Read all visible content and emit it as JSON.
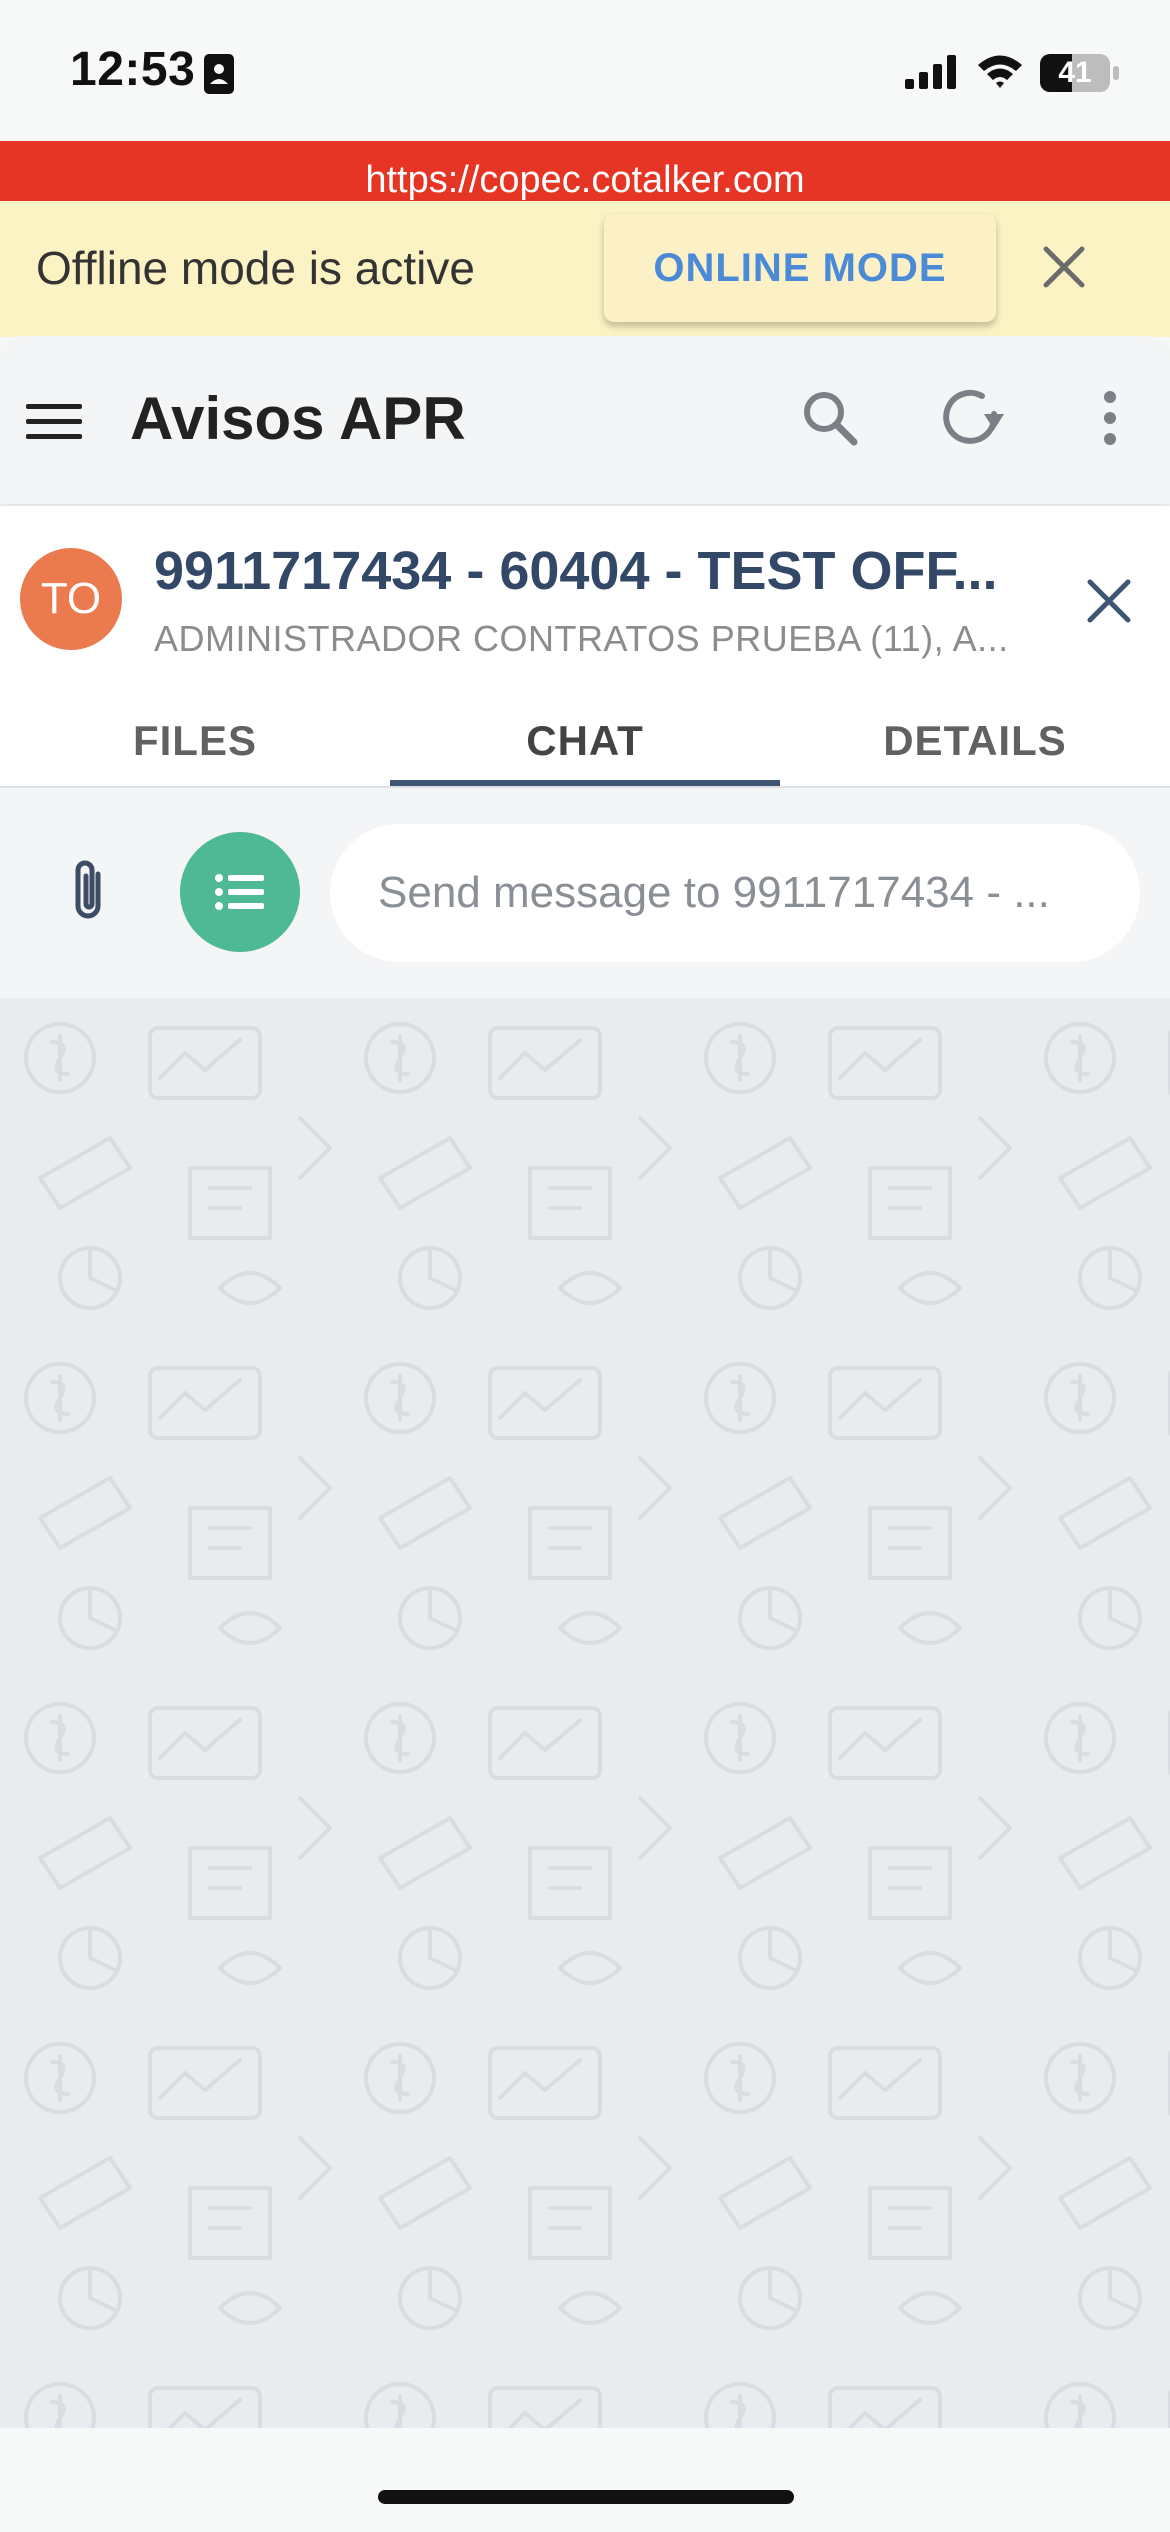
{
  "status_bar": {
    "time": "12:53",
    "battery_level": "41",
    "icons": [
      "id-card-icon",
      "cellular-signal-icon",
      "wifi-icon",
      "battery-icon"
    ]
  },
  "browser": {
    "url": "https://copec.cotalker.com"
  },
  "offline_banner": {
    "message": "Offline mode is active",
    "button_label": "ONLINE MODE",
    "background": "#fcf3c4",
    "button_color": "#4a8ad6"
  },
  "toolbar": {
    "title": "Avisos APR",
    "icons": [
      "menu-icon",
      "search-icon",
      "refresh-icon",
      "more-vertical-icon"
    ]
  },
  "conversation": {
    "avatar_initials": "TO",
    "avatar_color": "#ec7a4f",
    "title": "9911717434 - 60404 - TEST OFF...",
    "subtitle": "ADMINISTRADOR CONTRATOS PRUEBA (11), A..."
  },
  "tabs": [
    {
      "label": "FILES",
      "active": false
    },
    {
      "label": "CHAT",
      "active": true
    },
    {
      "label": "DETAILS",
      "active": false
    }
  ],
  "composer": {
    "placeholder": "Send message to 9911717434 - ...",
    "template_button_color": "#4fb894"
  },
  "colors": {
    "url_bar": "#e63425",
    "tab_indicator": "#3e5573",
    "chat_background": "#e9ebee"
  }
}
